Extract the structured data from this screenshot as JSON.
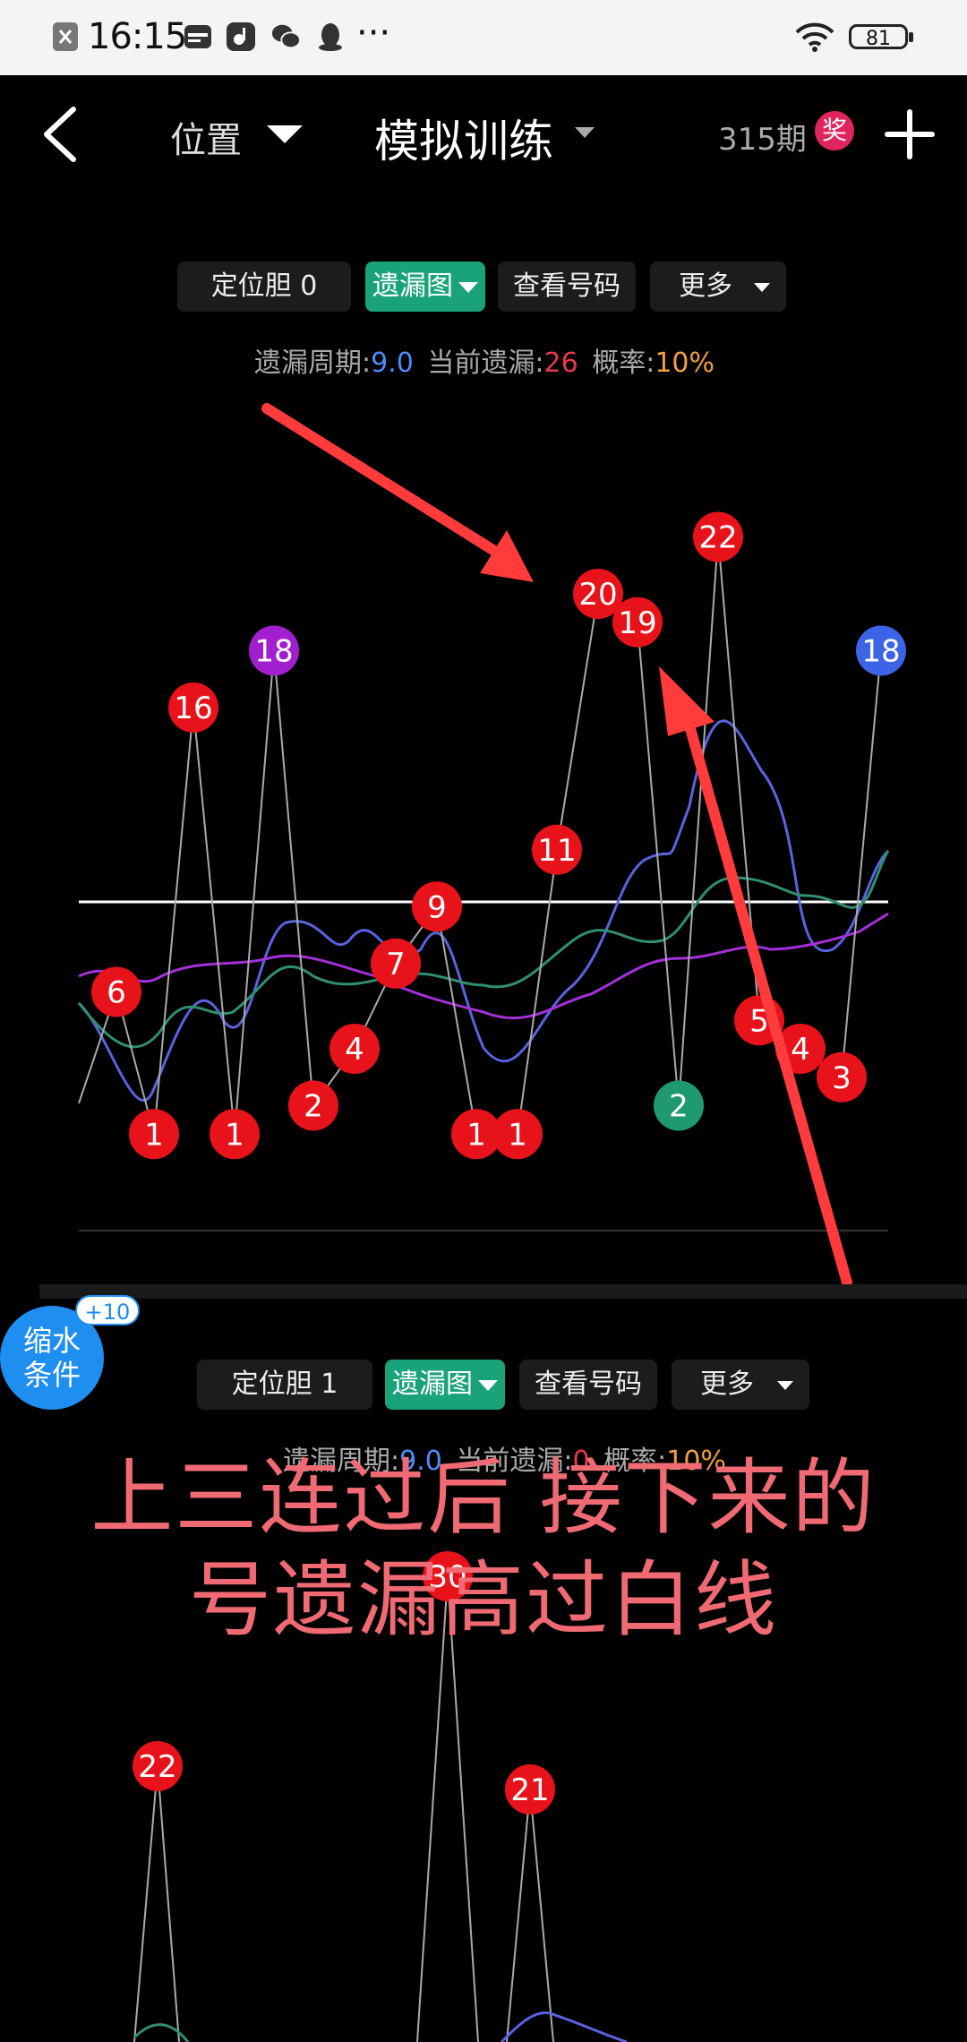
{
  "status_bar": {
    "time": "16:15",
    "more": "···",
    "battery": "81"
  },
  "nav": {
    "position_label": "位置",
    "title": "模拟训练",
    "issue": "315期",
    "award": "奖"
  },
  "panel1": {
    "toolbar": {
      "position_btn": "定位胆 0",
      "chart_btn": "遗漏图",
      "view_btn": "查看号码",
      "more_btn": "更多"
    },
    "stats": {
      "period_label": "遗漏周期:",
      "period_value": "9.0",
      "current_label": "当前遗漏:",
      "current_value": "26",
      "prob_label": "概率:",
      "prob_value": "10%"
    }
  },
  "panel2": {
    "toolbar": {
      "position_btn": "定位胆 1",
      "chart_btn": "遗漏图",
      "view_btn": "查看号码",
      "more_btn": "更多"
    },
    "stats": {
      "period_label": "遗漏周期:",
      "period_value": "9.0",
      "current_label": "当前遗漏:",
      "current_value": "0",
      "prob_label": "概率:",
      "prob_value": "10%"
    }
  },
  "fab": {
    "line1": "缩水",
    "line2": "条件",
    "badge": "+10"
  },
  "overlay": {
    "line1": "上三连过后 接下来的",
    "line2": "号遗漏高过白线"
  },
  "colors": {
    "red": "#e8131a",
    "purple": "#a21fd0",
    "blue": "#3d63e6",
    "green": "#1e9a6e",
    "accent": "#1aa37a"
  },
  "chart_data": [
    {
      "type": "line",
      "x": [
        1,
        2,
        3,
        4,
        5,
        6,
        7,
        8,
        9,
        10,
        11,
        12,
        13,
        14,
        15,
        16,
        17,
        18,
        19,
        20
      ],
      "values": [
        6,
        1,
        16,
        1,
        18,
        2,
        4,
        7,
        9,
        1,
        1,
        11,
        20,
        19,
        2,
        22,
        5,
        4,
        3,
        18
      ],
      "point_colors": [
        "red",
        "red",
        "red",
        "red",
        "purple",
        "red",
        "red",
        "red",
        "red",
        "red",
        "red",
        "red",
        "red",
        "red",
        "green",
        "red",
        "red",
        "red",
        "red",
        "blue"
      ],
      "ylim": [
        0,
        24
      ]
    },
    {
      "type": "line",
      "values": [
        22,
        30,
        21
      ]
    }
  ]
}
